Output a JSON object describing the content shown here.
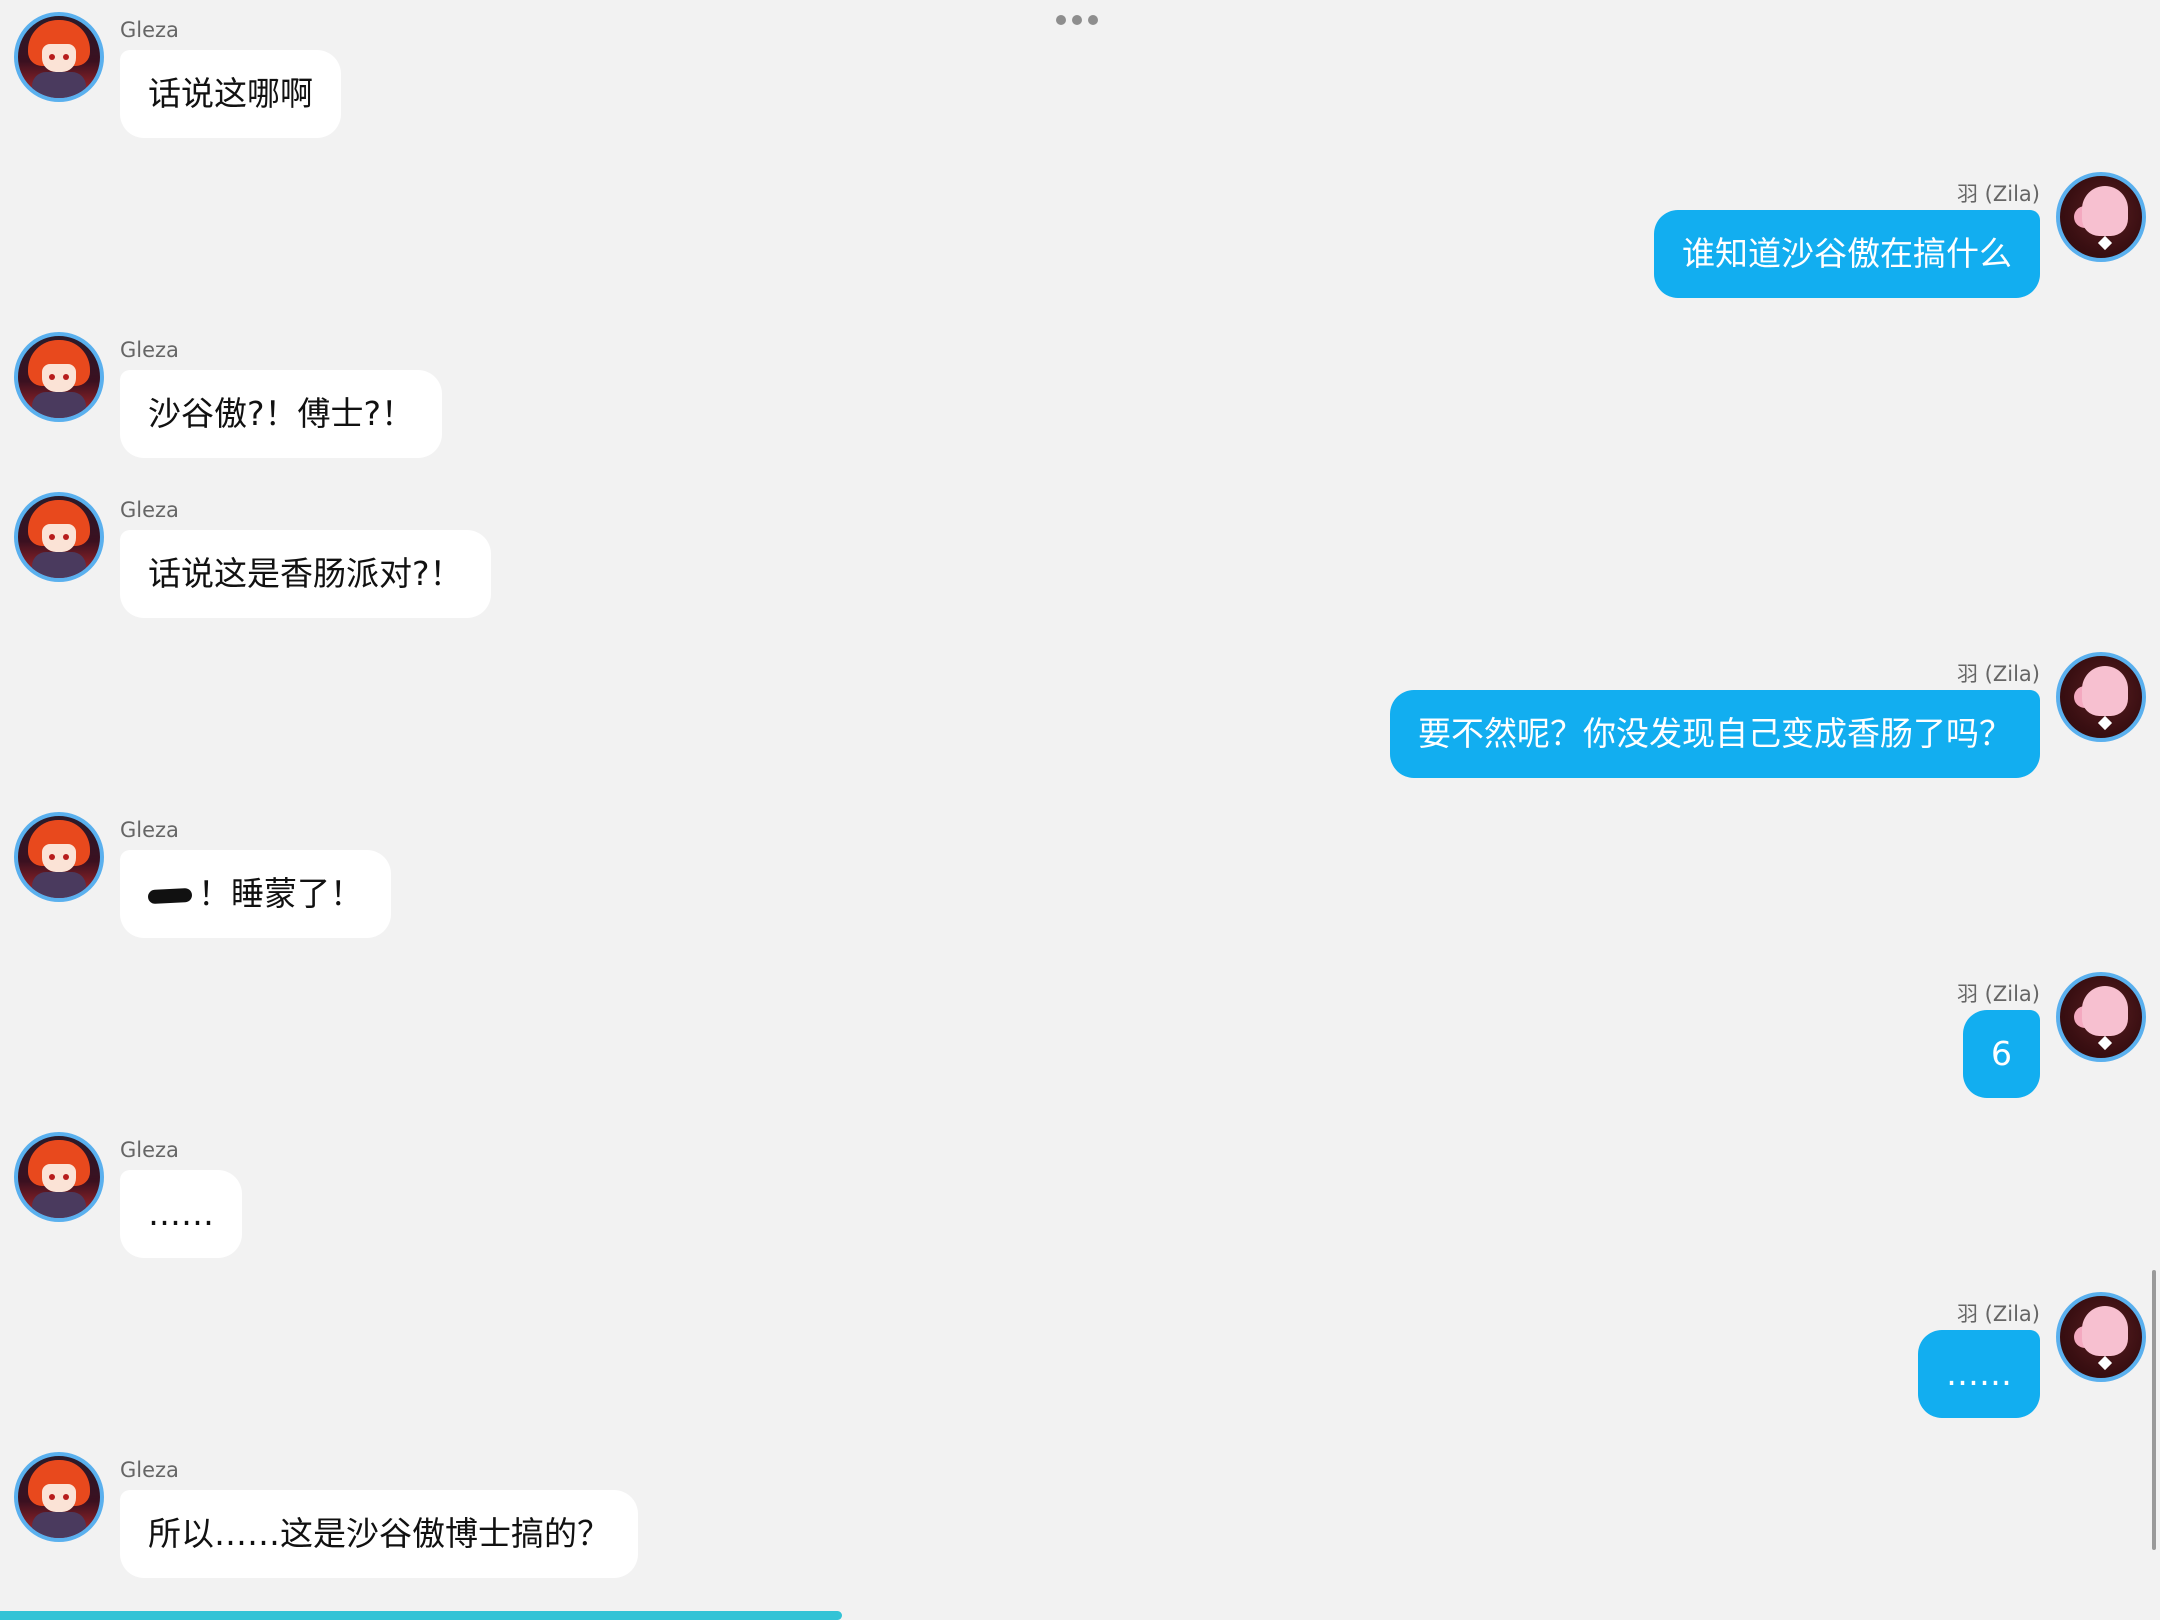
{
  "toolbar": {
    "more_icon": "ellipsis-icon"
  },
  "participants": {
    "left": {
      "name": "Gleza",
      "avatar_icon": "red-haired-girl-avatar"
    },
    "right": {
      "name": "羽 (Zila)",
      "avatar_icon": "pink-creature-avatar"
    }
  },
  "messages": [
    {
      "side": "left",
      "name": "Gleza",
      "text": "话说这哪啊"
    },
    {
      "side": "right",
      "name": "羽 (Zila)",
      "text": "谁知道沙谷傲在搞什么"
    },
    {
      "side": "left",
      "name": "Gleza",
      "text": "沙谷傲?！傅士?！"
    },
    {
      "side": "left",
      "name": "Gleza",
      "text": "话说这是香肠派对?！"
    },
    {
      "side": "right",
      "name": "羽 (Zila)",
      "text": "要不然呢？你没发现自己变成香肠了吗？"
    },
    {
      "side": "left",
      "name": "Gleza",
      "text": "！睡蒙了！",
      "redacted_prefix": true
    },
    {
      "side": "right",
      "name": "羽 (Zila)",
      "text": "6"
    },
    {
      "side": "left",
      "name": "Gleza",
      "text": "……"
    },
    {
      "side": "right",
      "name": "羽 (Zila)",
      "text": "……"
    },
    {
      "side": "left",
      "name": "Gleza",
      "text": "所以……这是沙谷傲博士搞的？"
    }
  ],
  "playback": {
    "progress_fraction": 0.39
  },
  "colors": {
    "background": "#f2f2f2",
    "left_bubble": "#ffffff",
    "right_bubble": "#12aef0",
    "avatar_ring": "#5ab0ee",
    "progress": "#33c3d6"
  }
}
